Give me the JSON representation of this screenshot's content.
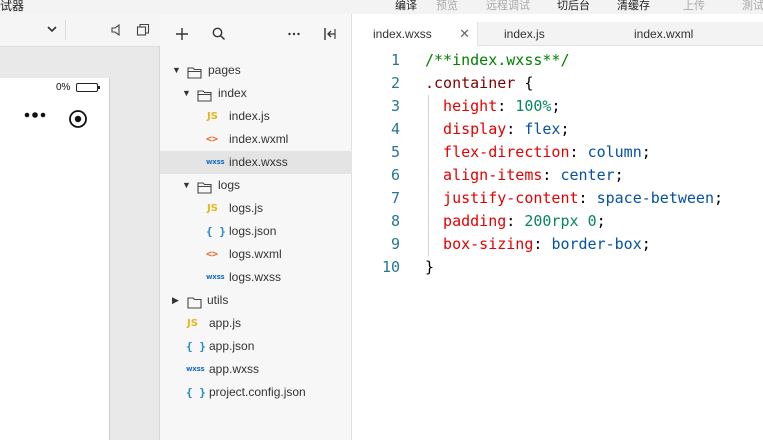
{
  "toolbar": {
    "app_title": "试器",
    "items": [
      {
        "label": "编译",
        "state": "active"
      },
      {
        "label": "预览",
        "state": "disabled"
      },
      {
        "label": "远程调试",
        "state": "disabled"
      },
      {
        "label": "切后台",
        "state": "active"
      },
      {
        "label": "清缓存",
        "state": "active"
      },
      {
        "label": "上传",
        "state": "disabled"
      },
      {
        "label": "測试",
        "state": "disabled"
      }
    ]
  },
  "simulator": {
    "battery_text": "0%",
    "icons": [
      "chevron-down-icon",
      "speaker-icon",
      "window-icon",
      "more-dots-icon",
      "record-icon"
    ]
  },
  "explorer": {
    "toolbar_icons": [
      "plus-icon",
      "search-icon",
      "ellipsis-icon",
      "collapse-panel-icon"
    ],
    "tree": [
      {
        "label": "pages",
        "type": "folder",
        "open": true,
        "depth": 0
      },
      {
        "label": "index",
        "type": "folder",
        "open": true,
        "depth": 1
      },
      {
        "label": "index.js",
        "type": "js",
        "depth": 2
      },
      {
        "label": "index.wxml",
        "type": "wxml",
        "depth": 2
      },
      {
        "label": "index.wxss",
        "type": "wxss",
        "depth": 2,
        "selected": true
      },
      {
        "label": "logs",
        "type": "folder",
        "open": true,
        "depth": 1
      },
      {
        "label": "logs.js",
        "type": "js",
        "depth": 2
      },
      {
        "label": "logs.json",
        "type": "json",
        "depth": 2
      },
      {
        "label": "logs.wxml",
        "type": "wxml",
        "depth": 2
      },
      {
        "label": "logs.wxss",
        "type": "wxss",
        "depth": 2
      },
      {
        "label": "utils",
        "type": "folder",
        "open": false,
        "depth": 0
      },
      {
        "label": "app.js",
        "type": "js",
        "depth": 0
      },
      {
        "label": "app.json",
        "type": "json",
        "depth": 0
      },
      {
        "label": "app.wxss",
        "type": "wxss",
        "depth": 0
      },
      {
        "label": "project.config.json",
        "type": "json",
        "depth": 0
      }
    ],
    "file_icon_glyphs": {
      "js": "JS",
      "wxml": "<>",
      "json": "{ }",
      "wxss": "wxss"
    }
  },
  "editor": {
    "tabs": [
      {
        "label": "index.wxss",
        "active": true,
        "closable": true
      },
      {
        "label": "index.js",
        "active": false
      },
      {
        "label": "index.wxml",
        "active": false
      }
    ],
    "lines": [
      {
        "n": "1",
        "tokens": [
          {
            "t": "/**index.wxss**/",
            "k": "comment"
          }
        ]
      },
      {
        "n": "2",
        "tokens": [
          {
            "t": ".container",
            "k": "selector"
          },
          {
            "t": " {",
            "k": "punct"
          }
        ]
      },
      {
        "n": "3",
        "indent": true,
        "tokens": [
          {
            "t": "  height",
            "k": "prop"
          },
          {
            "t": ": ",
            "k": "punct"
          },
          {
            "t": "100%",
            "k": "num"
          },
          {
            "t": ";",
            "k": "punct"
          }
        ]
      },
      {
        "n": "4",
        "indent": true,
        "tokens": [
          {
            "t": "  display",
            "k": "prop"
          },
          {
            "t": ": ",
            "k": "punct"
          },
          {
            "t": "flex",
            "k": "val"
          },
          {
            "t": ";",
            "k": "punct"
          }
        ]
      },
      {
        "n": "5",
        "indent": true,
        "tokens": [
          {
            "t": "  flex-direction",
            "k": "prop"
          },
          {
            "t": ": ",
            "k": "punct"
          },
          {
            "t": "column",
            "k": "val"
          },
          {
            "t": ";",
            "k": "punct"
          }
        ]
      },
      {
        "n": "6",
        "indent": true,
        "tokens": [
          {
            "t": "  align-items",
            "k": "prop"
          },
          {
            "t": ": ",
            "k": "punct"
          },
          {
            "t": "center",
            "k": "val"
          },
          {
            "t": ";",
            "k": "punct"
          }
        ]
      },
      {
        "n": "7",
        "indent": true,
        "tokens": [
          {
            "t": "  justify-content",
            "k": "prop"
          },
          {
            "t": ": ",
            "k": "punct"
          },
          {
            "t": "space-between",
            "k": "val"
          },
          {
            "t": ";",
            "k": "punct"
          }
        ]
      },
      {
        "n": "8",
        "indent": true,
        "tokens": [
          {
            "t": "  padding",
            "k": "prop"
          },
          {
            "t": ": ",
            "k": "punct"
          },
          {
            "t": "200rpx",
            "k": "num"
          },
          {
            "t": " ",
            "k": "punct"
          },
          {
            "t": "0",
            "k": "num"
          },
          {
            "t": ";",
            "k": "punct"
          }
        ]
      },
      {
        "n": "9",
        "indent": true,
        "tokens": [
          {
            "t": "  box-sizing",
            "k": "prop"
          },
          {
            "t": ": ",
            "k": "punct"
          },
          {
            "t": "border-box",
            "k": "val"
          },
          {
            "t": ";",
            "k": "punct"
          }
        ]
      },
      {
        "n": "10",
        "tokens": [
          {
            "t": "}",
            "k": "punct"
          }
        ]
      }
    ],
    "colors": {
      "line_number": "#237893",
      "comment": "#008000",
      "selector": "#800000",
      "property": "#e50000",
      "number": "#098658",
      "value": "#0451a5"
    }
  }
}
